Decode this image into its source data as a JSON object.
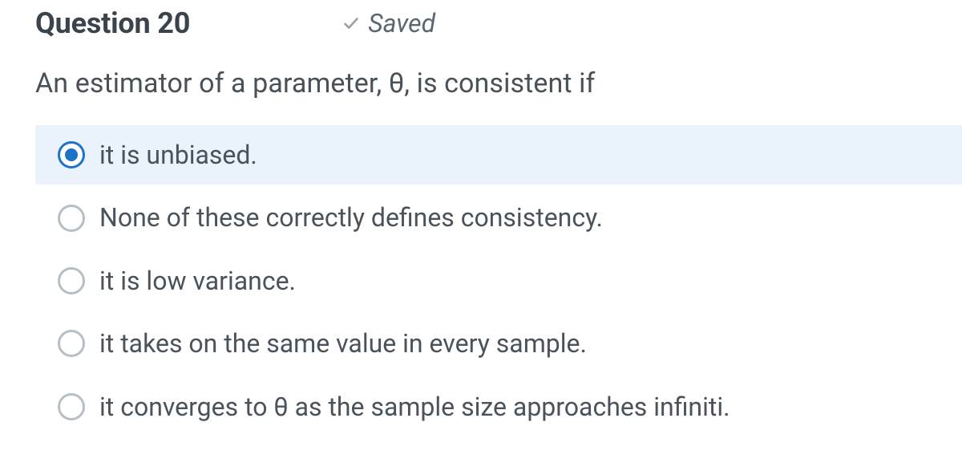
{
  "header": {
    "title": "Question 20",
    "saved_label": "Saved"
  },
  "prompt": "An estimator of a parameter, θ, is consistent if",
  "options": [
    {
      "label": "it is unbiased.",
      "selected": true
    },
    {
      "label": "None of these correctly defines consistency.",
      "selected": false
    },
    {
      "label": "it is low variance.",
      "selected": false
    },
    {
      "label": "it takes on the same value in every sample.",
      "selected": false
    },
    {
      "label": "it converges to θ as the sample size approaches infiniti.",
      "selected": false
    }
  ],
  "colors": {
    "accent": "#1d73c9",
    "selected_bg": "#eaf2fb",
    "text": "#3f4a54",
    "muted": "#b6bec6"
  }
}
